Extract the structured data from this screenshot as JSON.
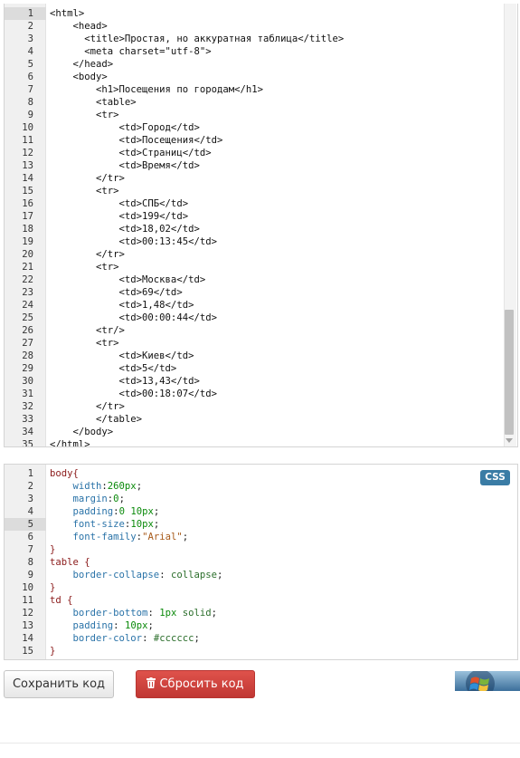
{
  "html_editor": {
    "lines": [
      {
        "n": "1",
        "text": "<html>"
      },
      {
        "n": "2",
        "text": "    <head>"
      },
      {
        "n": "3",
        "text": "      <title>Простая, но аккуратная таблица</title>"
      },
      {
        "n": "4",
        "text": "      <meta charset=\"utf-8\">"
      },
      {
        "n": "5",
        "text": "    </head>"
      },
      {
        "n": "6",
        "text": "    <body>"
      },
      {
        "n": "7",
        "text": "        <h1>Посещения по городам</h1>"
      },
      {
        "n": "8",
        "text": "        <table>"
      },
      {
        "n": "9",
        "text": "        <tr>"
      },
      {
        "n": "10",
        "text": "            <td>Город</td>"
      },
      {
        "n": "11",
        "text": "            <td>Посещения</td>"
      },
      {
        "n": "12",
        "text": "            <td>Страниц</td>"
      },
      {
        "n": "13",
        "text": "            <td>Время</td>"
      },
      {
        "n": "14",
        "text": "        </tr>"
      },
      {
        "n": "15",
        "text": "        <tr>"
      },
      {
        "n": "16",
        "text": "            <td>СПБ</td>"
      },
      {
        "n": "17",
        "text": "            <td>199</td>"
      },
      {
        "n": "18",
        "text": "            <td>18,02</td>"
      },
      {
        "n": "19",
        "text": "            <td>00:13:45</td>"
      },
      {
        "n": "20",
        "text": "        </tr>"
      },
      {
        "n": "21",
        "text": "        <tr>"
      },
      {
        "n": "22",
        "text": "            <td>Москва</td>"
      },
      {
        "n": "23",
        "text": "            <td>69</td>"
      },
      {
        "n": "24",
        "text": "            <td>1,48</td>"
      },
      {
        "n": "25",
        "text": "            <td>00:00:44</td>"
      },
      {
        "n": "26",
        "text": "        <tr/>"
      },
      {
        "n": "27",
        "text": "        <tr>"
      },
      {
        "n": "28",
        "text": "            <td>Киев</td>"
      },
      {
        "n": "29",
        "text": "            <td>5</td>"
      },
      {
        "n": "30",
        "text": "            <td>13,43</td>"
      },
      {
        "n": "31",
        "text": "            <td>00:18:07</td>"
      },
      {
        "n": "32",
        "text": "        </tr>"
      },
      {
        "n": "33",
        "text": "        </table>"
      },
      {
        "n": "34",
        "text": "    </body>"
      },
      {
        "n": "35",
        "text": "</html>"
      }
    ]
  },
  "css_editor": {
    "badge": "CSS",
    "lines": [
      {
        "n": "1",
        "parts": [
          {
            "t": "body{",
            "c": "css-sel"
          }
        ]
      },
      {
        "n": "2",
        "parts": [
          {
            "t": "    width",
            "c": "css-prop"
          },
          {
            "t": ":",
            "c": ""
          },
          {
            "t": "260px",
            "c": "css-num"
          },
          {
            "t": ";",
            "c": ""
          }
        ]
      },
      {
        "n": "3",
        "parts": [
          {
            "t": "    margin",
            "c": "css-prop"
          },
          {
            "t": ":",
            "c": ""
          },
          {
            "t": "0",
            "c": "css-num"
          },
          {
            "t": ";",
            "c": ""
          }
        ]
      },
      {
        "n": "4",
        "parts": [
          {
            "t": "    padding",
            "c": "css-prop"
          },
          {
            "t": ":",
            "c": ""
          },
          {
            "t": "0 10px",
            "c": "css-num"
          },
          {
            "t": ";",
            "c": ""
          }
        ]
      },
      {
        "n": "5",
        "parts": [
          {
            "t": "    font-size",
            "c": "css-prop"
          },
          {
            "t": ":",
            "c": ""
          },
          {
            "t": "10px",
            "c": "css-num"
          },
          {
            "t": ";",
            "c": ""
          }
        ]
      },
      {
        "n": "6",
        "parts": [
          {
            "t": "    font-family",
            "c": "css-prop"
          },
          {
            "t": ":",
            "c": ""
          },
          {
            "t": "\"Arial\"",
            "c": "css-str"
          },
          {
            "t": ";",
            "c": ""
          }
        ]
      },
      {
        "n": "7",
        "parts": [
          {
            "t": "}",
            "c": "css-sel"
          }
        ]
      },
      {
        "n": "8",
        "parts": [
          {
            "t": "table {",
            "c": "css-sel"
          }
        ]
      },
      {
        "n": "9",
        "parts": [
          {
            "t": "    border-collapse",
            "c": "css-prop"
          },
          {
            "t": ": ",
            "c": ""
          },
          {
            "t": "collapse",
            "c": "css-val"
          },
          {
            "t": ";",
            "c": ""
          }
        ]
      },
      {
        "n": "10",
        "parts": [
          {
            "t": "}",
            "c": "css-sel"
          }
        ]
      },
      {
        "n": "11",
        "parts": [
          {
            "t": "td {",
            "c": "css-sel"
          }
        ]
      },
      {
        "n": "12",
        "parts": [
          {
            "t": "    border-bottom",
            "c": "css-prop"
          },
          {
            "t": ": ",
            "c": ""
          },
          {
            "t": "1px",
            "c": "css-num"
          },
          {
            "t": " ",
            "c": ""
          },
          {
            "t": "solid",
            "c": "css-val"
          },
          {
            "t": ";",
            "c": ""
          }
        ]
      },
      {
        "n": "13",
        "parts": [
          {
            "t": "    padding",
            "c": "css-prop"
          },
          {
            "t": ": ",
            "c": ""
          },
          {
            "t": "10px",
            "c": "css-num"
          },
          {
            "t": ";",
            "c": ""
          }
        ]
      },
      {
        "n": "14",
        "parts": [
          {
            "t": "    border-color",
            "c": "css-prop"
          },
          {
            "t": ": ",
            "c": ""
          },
          {
            "t": "#cccccc",
            "c": "css-val"
          },
          {
            "t": ";",
            "c": ""
          }
        ]
      },
      {
        "n": "15",
        "parts": [
          {
            "t": "}",
            "c": "css-sel"
          }
        ]
      }
    ]
  },
  "buttons": {
    "save_label": "Сохранить код",
    "reset_label": "Сбросить код"
  }
}
